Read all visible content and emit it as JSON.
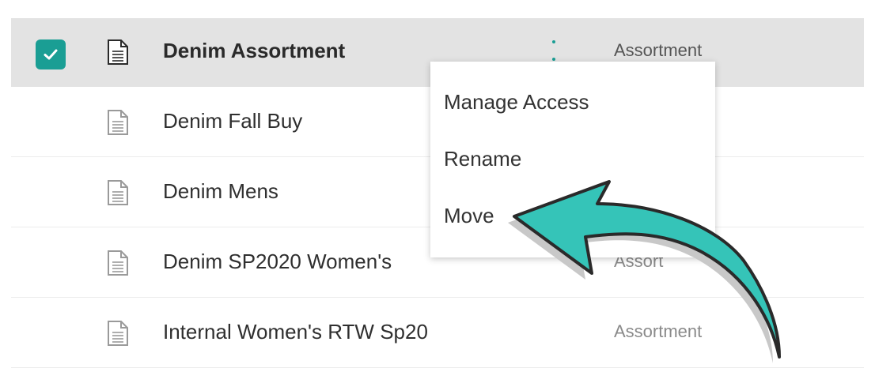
{
  "rows": [
    {
      "name": "Denim Assortment",
      "type": "Assortment",
      "selected": true
    },
    {
      "name": "Denim Fall Buy",
      "type": "",
      "selected": false
    },
    {
      "name": "Denim Mens",
      "type": "",
      "selected": false
    },
    {
      "name": "Denim SP2020 Women's",
      "type": "Assort",
      "selected": false
    },
    {
      "name": "Internal Women's RTW Sp20",
      "type": "Assortment",
      "selected": false
    }
  ],
  "context_menu": {
    "items": [
      {
        "label": "Manage Access"
      },
      {
        "label": "Rename"
      },
      {
        "label": "Move"
      }
    ]
  },
  "colors": {
    "accent": "#1a9e94",
    "selected_row": "#e3e3e3",
    "arrow_fill": "#35c4b8",
    "arrow_stroke": "#2a2a2a"
  },
  "icons": {
    "checkbox": "check-icon",
    "row_icon": "document-icon",
    "row_menu": "kebab-menu-icon",
    "callout": "curved-arrow-icon"
  }
}
